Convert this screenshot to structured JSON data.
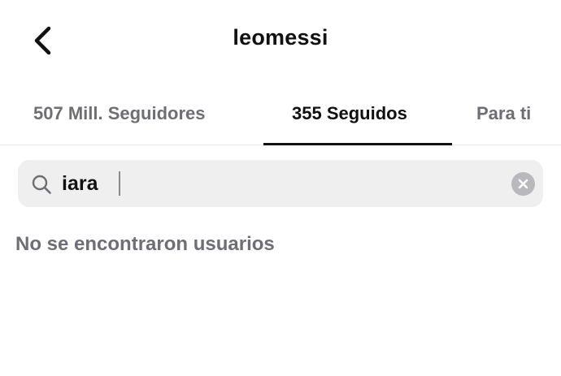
{
  "header": {
    "title": "leomessi",
    "back_icon": "chevron-left-icon"
  },
  "tabs": [
    {
      "label": "507 Mill. Seguidores",
      "active": false
    },
    {
      "label": "355 Seguidos",
      "active": true
    },
    {
      "label": "Para ti",
      "active": false
    }
  ],
  "search": {
    "value": "iara",
    "icon": "search-icon",
    "clear_icon": "clear-circle-icon"
  },
  "results": {
    "empty_message": "No se encontraron usuarios"
  },
  "colors": {
    "text_primary": "#111111",
    "text_secondary": "#6e6e73",
    "search_background": "#efefef",
    "clear_button": "#b8b8bd"
  }
}
